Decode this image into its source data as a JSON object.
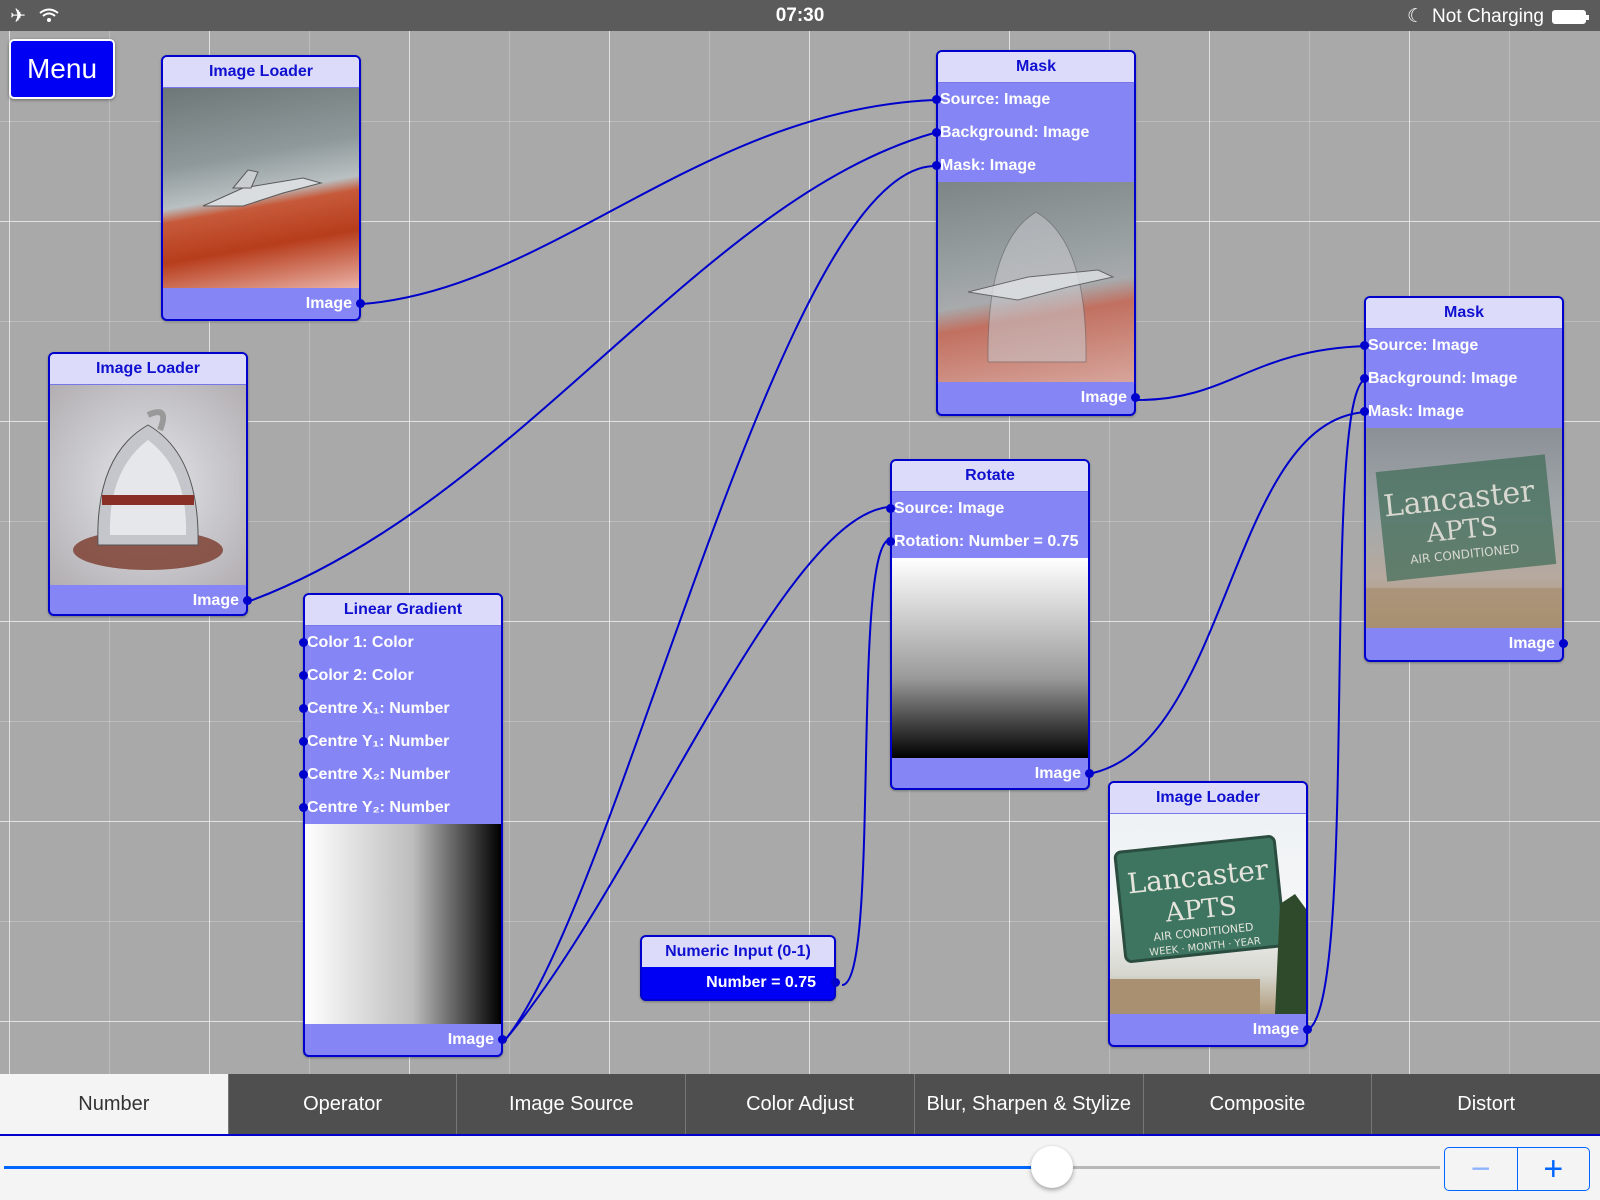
{
  "status_bar": {
    "left_icons": [
      "airplane-icon",
      "wifi-icon"
    ],
    "time": "07:30",
    "charging": "Not Charging",
    "battery_icon": "battery-icon",
    "moon_icon": "moon-icon"
  },
  "menu_button": "Menu",
  "nodes": {
    "image_loader_1": {
      "title": "Image Loader",
      "output": "Image"
    },
    "image_loader_2": {
      "title": "Image Loader",
      "output": "Image"
    },
    "image_loader_3": {
      "title": "Image Loader",
      "output": "Image"
    },
    "mask_1": {
      "title": "Mask",
      "inputs": [
        "Source: Image",
        "Background: Image",
        "Mask: Image"
      ],
      "output": "Image"
    },
    "mask_2": {
      "title": "Mask",
      "inputs": [
        "Source: Image",
        "Background: Image",
        "Mask: Image"
      ],
      "output": "Image"
    },
    "rotate": {
      "title": "Rotate",
      "inputs": [
        "Source: Image",
        "Rotation: Number = 0.75"
      ],
      "output": "Image"
    },
    "linear_gradient": {
      "title": "Linear Gradient",
      "inputs": [
        "Color 1: Color",
        "Color 2: Color",
        "Centre X₁: Number",
        "Centre Y₁: Number",
        "Centre X₂: Number",
        "Centre Y₂: Number"
      ],
      "output": "Image"
    },
    "numeric_input": {
      "title": "Numeric Input (0-1)",
      "output": "Number = 0.75"
    }
  },
  "sign_text": {
    "line1": "Lancaster",
    "line2": "APTS",
    "line3": "AIR CONDITIONED",
    "line4": "WEEK · MONTH · YEAR"
  },
  "tabs": [
    "Number",
    "Operator",
    "Image Source",
    "Color Adjust",
    "Blur, Sharpen & Stylize",
    "Composite",
    "Distort"
  ],
  "active_tab": "Number",
  "slider": {
    "value": 0.73
  },
  "stepper": {
    "minus": "−",
    "plus": "+"
  },
  "colors": {
    "wire": "#0000cc",
    "node_body": "#8585f5",
    "node_header": "#dcdcfa",
    "accent": "#0066ff"
  }
}
